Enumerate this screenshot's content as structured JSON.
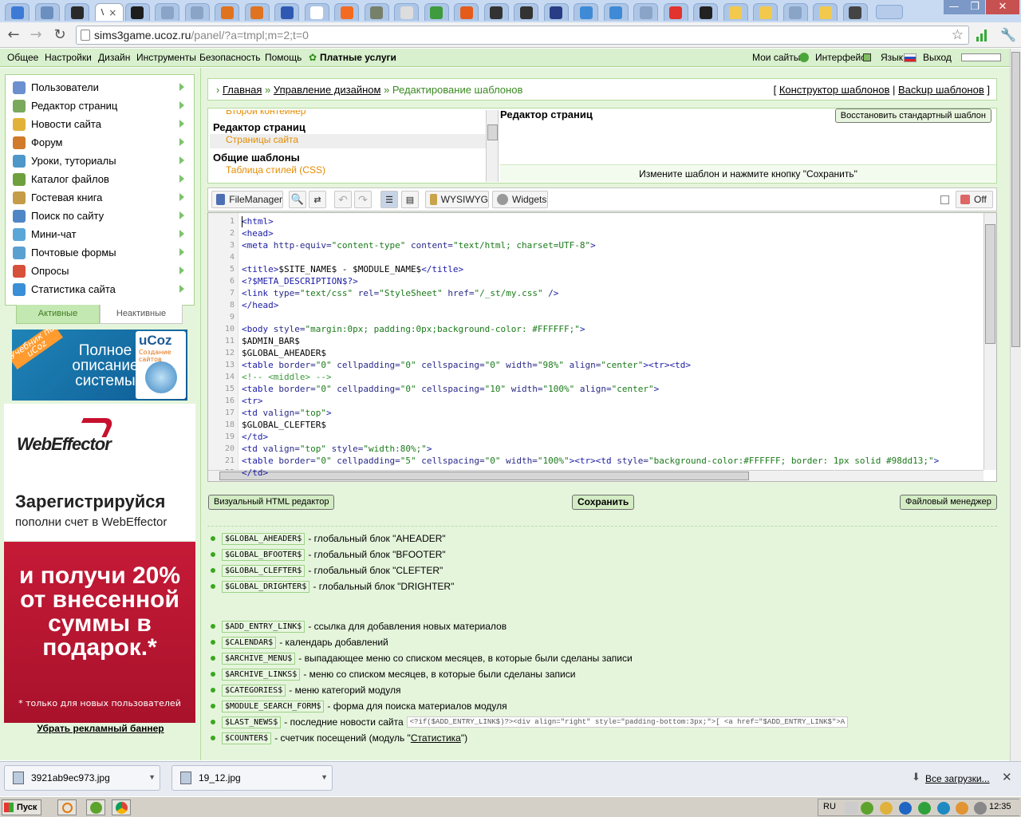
{
  "browser": {
    "active_tab_label": "\\",
    "tab_icons": [
      "browser-icon",
      "image-icon",
      "game-icon",
      "site-icon",
      "ia-icon",
      "ucoz-icon",
      "ucoz-icon",
      "puzzle-icon",
      "puzzle-icon",
      "bracket-icon",
      "b-icon",
      "blogger-icon",
      "photo-icon",
      "tree-icon",
      "leaf-icon",
      "joomla-icon",
      "minus-icon",
      "minus-icon",
      "m-icon",
      "shield-icon",
      "shield-icon",
      "ucoz-icon",
      "windows-icon",
      "plit-icon",
      "note-icon",
      "note-icon",
      "ucoz-icon",
      "note-icon",
      "globe-icon"
    ],
    "url_host": "sims3game.ucoz.ru",
    "url_path": "/panel/?a=tmpl;m=2;t=0"
  },
  "topmenu": {
    "items": [
      "Общее",
      "Настройки",
      "Дизайн",
      "Инструменты",
      "Безопасность",
      "Помощь"
    ],
    "paid": "Платные услуги",
    "right": [
      "Мои сайты",
      "Интерфейс",
      "Язык",
      "Выход"
    ]
  },
  "sidebar": {
    "items": [
      {
        "label": "Пользователи",
        "icon": "users-icon"
      },
      {
        "label": "Редактор страниц",
        "icon": "page-icon"
      },
      {
        "label": "Новости сайта",
        "icon": "news-icon"
      },
      {
        "label": "Форум",
        "icon": "forum-icon"
      },
      {
        "label": "Уроки, туториалы",
        "icon": "lesson-icon"
      },
      {
        "label": "Каталог файлов",
        "icon": "catalog-icon"
      },
      {
        "label": "Гостевая книга",
        "icon": "guestbook-icon"
      },
      {
        "label": "Поиск по сайту",
        "icon": "search-icon"
      },
      {
        "label": "Мини-чат",
        "icon": "chat-icon"
      },
      {
        "label": "Почтовые формы",
        "icon": "mail-icon"
      },
      {
        "label": "Опросы",
        "icon": "poll-icon"
      },
      {
        "label": "Статистика сайта",
        "icon": "stats-icon"
      }
    ],
    "tab_active": "Активные",
    "tab_inactive": "Неактивные"
  },
  "banner1": {
    "ribbon": "Учебник по uCoz",
    "text": "Полное описание системы",
    "brand": "uCoz",
    "sub": "Создание сайтов"
  },
  "banner2": {
    "logo": "WebEffector",
    "register": "Зарегистрируйся",
    "topup": "пополни счет в WebEffector",
    "offer": "и получи 20% от внесенной суммы в подарок.*",
    "note": "* только для новых пользователей"
  },
  "remove_banner": "Убрать рекламный баннер",
  "breadcrumb": {
    "home": "Главная",
    "design": "Управление дизайном",
    "current": "Редактирование шаблонов",
    "constructor": "Конструктор шаблонов",
    "backup": "Backup шаблонов"
  },
  "templates": {
    "list": [
      {
        "text": "Второй контейнер",
        "kind": "o"
      },
      {
        "text": "Редактор страниц",
        "kind": "h"
      },
      {
        "text": "Страницы сайта",
        "kind": "o"
      },
      {
        "text": "Общие шаблоны",
        "kind": "h"
      },
      {
        "text": "Таблица стилей (CSS)",
        "kind": "o"
      }
    ],
    "current_name": "Редактор страниц",
    "restore_btn": "Восстановить стандартный шаблон",
    "hint": "Измените шаблон и нажмите кнопку \"Сохранить\""
  },
  "toolbar": {
    "filemanager": "FileManager",
    "wysiwyg": "WYSIWYG",
    "widgets": "Widgets",
    "off": "Off"
  },
  "code_lines": [
    "<html>",
    "<head>",
    "<meta http-equiv=\"content-type\" content=\"text/html; charset=UTF-8\">",
    "",
    "<title>$SITE_NAME$ - $MODULE_NAME$</title>",
    "<?$META_DESCRIPTION$?>",
    "<link type=\"text/css\" rel=\"StyleSheet\" href=\"/_st/my.css\" />",
    "</head>",
    "",
    "<body style=\"margin:0px; padding:0px;background-color: #FFFFFF;\">",
    "$ADMIN_BAR$",
    "$GLOBAL_AHEADER$",
    "<table border=\"0\" cellpadding=\"0\" cellspacing=\"0\" width=\"98%\" align=\"center\"><tr><td>",
    "<!-- <middle> -->",
    "<table border=\"0\" cellpadding=\"0\" cellspacing=\"10\" width=\"100%\" align=\"center\">",
    "<tr>",
    "<td valign=\"top\">",
    "$GLOBAL_CLEFTER$",
    "</td>",
    "<td valign=\"top\" style=\"width:80%;\">",
    "<table border=\"0\" cellpadding=\"5\" cellspacing=\"0\" width=\"100%\"><tr><td style=\"background-color:#FFFFFF; border: 1px solid #98dd13;\"><",
    "</td>"
  ],
  "buttons": {
    "visual": "Визуальный HTML редактор",
    "save": "Сохранить",
    "filemanager": "Файловый менеджер"
  },
  "vars_global": [
    {
      "code": "$GLOBAL_AHEADER$",
      "desc": "- глобальный блок \"AHEADER\""
    },
    {
      "code": "$GLOBAL_BFOOTER$",
      "desc": "- глобальный блок \"BFOOTER\""
    },
    {
      "code": "$GLOBAL_CLEFTER$",
      "desc": "- глобальный блок \"CLEFTER\""
    },
    {
      "code": "$GLOBAL_DRIGHTER$",
      "desc": "- глобальный блок \"DRIGHTER\""
    }
  ],
  "vars_module": [
    {
      "code": "$ADD_ENTRY_LINK$",
      "desc": "- ссылка для добавления новых материалов"
    },
    {
      "code": "$CALENDAR$",
      "desc": "- календарь добавлений"
    },
    {
      "code": "$ARCHIVE_MENU$",
      "desc": "- выпадающее меню со списком месяцев, в которые были сделаны записи"
    },
    {
      "code": "$ARCHIVE_LINKS$",
      "desc": "- меню со списком месяцев, в которые были сделаны записи"
    },
    {
      "code": "$CATEGORIES$",
      "desc": "- меню категорий модуля"
    },
    {
      "code": "$MODULE_SEARCH_FORM$",
      "desc": "- форма для поиска материалов модуля"
    },
    {
      "code": "$LAST_NEWS$",
      "desc": "- последние новости сайта"
    },
    {
      "code": "$COUNTER$",
      "desc": "- счетчик посещений (модуль \""
    }
  ],
  "last_news_snippet": "<?if($ADD_ENTRY_LINK$)?><div align=\"right\" style=\"padding-bottom:3px;\">[ <a href=\"$ADD_ENTRY_LINK$\">A",
  "counter_link": "Статистика",
  "counter_end": "\")",
  "downloads": {
    "items": [
      "3921ab9ec973.jpg",
      "19_12.jpg"
    ],
    "all": "Все загрузки..."
  },
  "taskbar": {
    "start": "Пуск",
    "lang": "RU",
    "time": "12:35"
  }
}
